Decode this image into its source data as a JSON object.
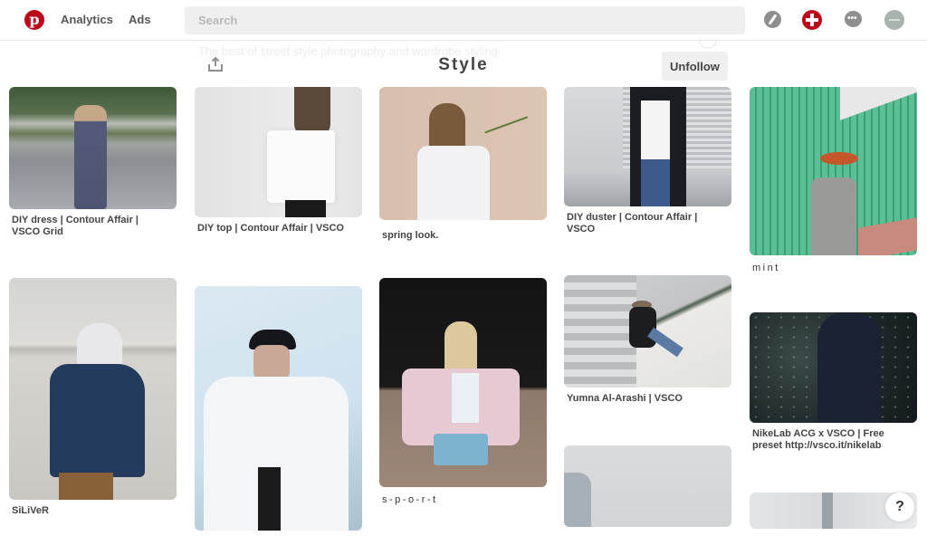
{
  "header": {
    "logo_letter": "p",
    "nav": [
      "Analytics",
      "Ads"
    ],
    "search_placeholder": "Search",
    "icons": [
      "explore-compass-icon",
      "add-pin-plus-icon",
      "messages-chat-icon",
      "profile-avatar-icon"
    ],
    "chat_glyph": "•••",
    "brand_color": "#bd081c"
  },
  "board": {
    "description": "The best of street style photography and wardrobe styling.",
    "title": "Style",
    "unfollow_label": "Unfollow"
  },
  "pins": [
    {
      "caption": "DIY dress | Contour Affair | VSCO Grid"
    },
    {
      "caption": "DIY top | Contour Affair | VSCO"
    },
    {
      "caption": "spring look."
    },
    {
      "caption": "DIY duster | Contour Affair | VSCO"
    },
    {
      "caption": "mint"
    },
    {
      "caption": "SiLiVeR"
    },
    {
      "caption": ""
    },
    {
      "caption": "s-p-o-r-t"
    },
    {
      "caption": "Yumna Al-Arashi | VSCO"
    },
    {
      "caption": "NikeLab ACG x VSCO | Free preset http://vsco.it/nikelab"
    },
    {
      "caption": ""
    },
    {
      "caption": ""
    }
  ],
  "help_label": "?"
}
